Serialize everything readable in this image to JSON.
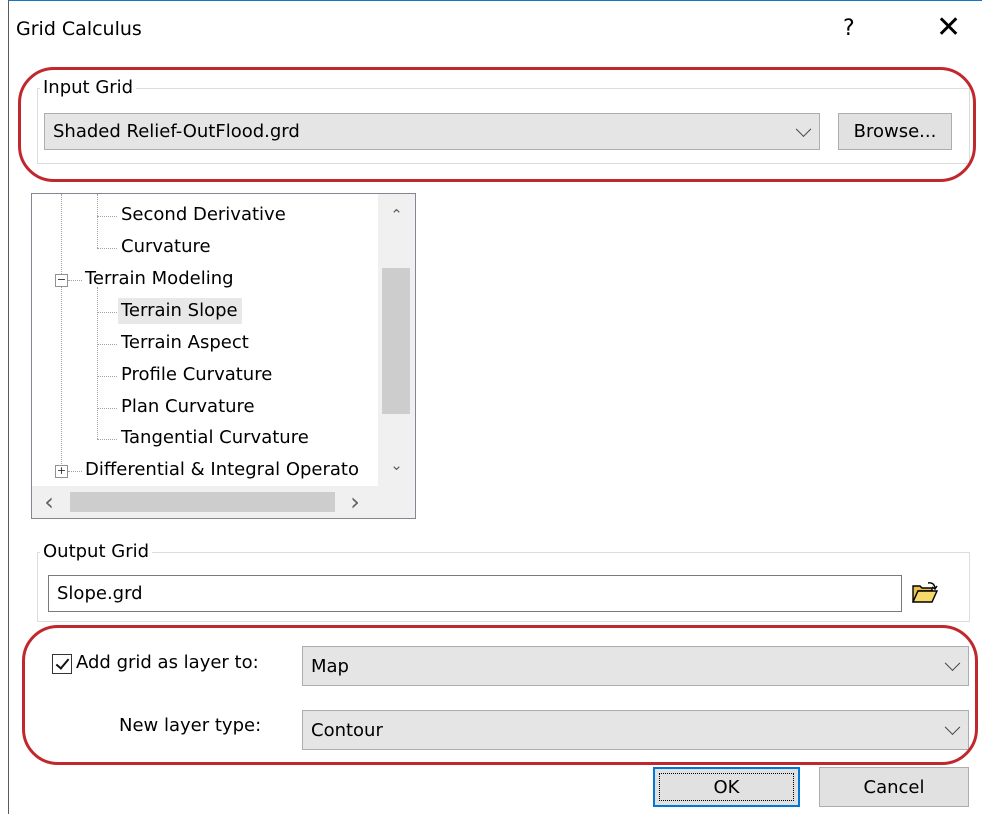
{
  "window": {
    "title": "Grid Calculus",
    "help_label": "?",
    "close_label": "✕"
  },
  "input_grid": {
    "legend": "Input Grid",
    "selected": "Shaded Relief-OutFlood.grd",
    "browse_label": "Browse..."
  },
  "tree": {
    "items": [
      {
        "label": "Second Derivative",
        "level": 2
      },
      {
        "label": "Curvature",
        "level": 2
      },
      {
        "label": "Terrain Modeling",
        "level": 1,
        "expander": "−"
      },
      {
        "label": "Terrain Slope",
        "level": 2,
        "selected": true
      },
      {
        "label": "Terrain Aspect",
        "level": 2
      },
      {
        "label": "Profile Curvature",
        "level": 2
      },
      {
        "label": "Plan Curvature",
        "level": 2
      },
      {
        "label": "Tangential Curvature",
        "level": 2
      },
      {
        "label": "Differential & Integral Operato",
        "level": 1,
        "expander": "+"
      }
    ],
    "scroll_up": "⌃",
    "scroll_down": "⌄",
    "scroll_left": "‹",
    "scroll_right": "›"
  },
  "output_grid": {
    "legend": "Output Grid",
    "value": "Slope.grd",
    "folder_icon": "open-folder-icon"
  },
  "layer": {
    "add_checked": true,
    "add_label": "Add grid as layer to:",
    "add_value": "Map",
    "type_label": "New layer type:",
    "type_value": "Contour"
  },
  "buttons": {
    "ok_label": "OK",
    "cancel_label": "Cancel"
  },
  "colors": {
    "highlight_oval": "#c0282e",
    "default_button_border": "#0078d7",
    "title_accent": "#1e73be"
  }
}
